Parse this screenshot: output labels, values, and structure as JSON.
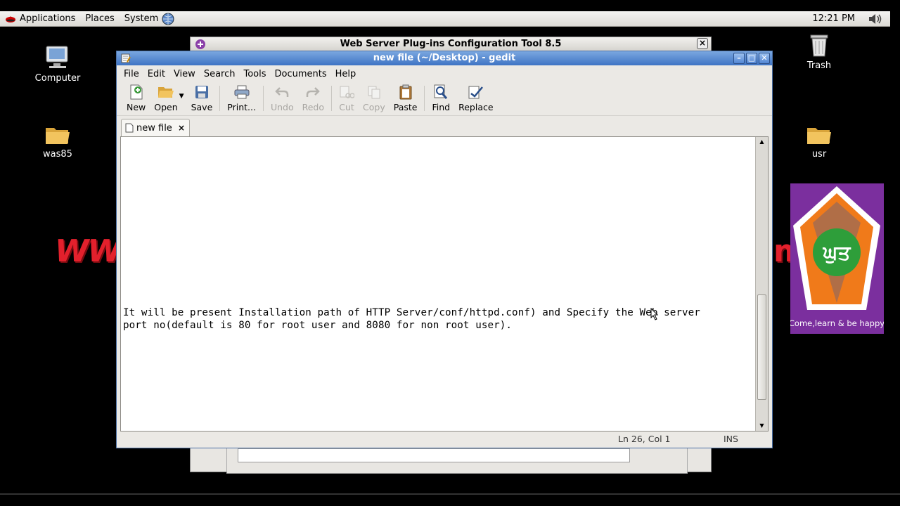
{
  "top_panel": {
    "applications": "Applications",
    "places": "Places",
    "system": "System",
    "clock": "12:21 PM"
  },
  "desktop": {
    "icons": [
      {
        "label": "Computer"
      },
      {
        "label": "was85"
      },
      {
        "label": "Trash"
      },
      {
        "label": "usr"
      }
    ],
    "watermark_left": "WW",
    "watermark_right": "m",
    "logo_text": "Come,learn & be happy",
    "logo_letters": "ਘੁਤ"
  },
  "background_window": {
    "title": "Web Server Plug-ins Configuration Tool 8.5",
    "close_label": "×"
  },
  "gedit": {
    "title": "new file (~/Desktop) - gedit",
    "menu": {
      "file": "File",
      "edit": "Edit",
      "view": "View",
      "search": "Search",
      "tools": "Tools",
      "documents": "Documents",
      "help": "Help"
    },
    "toolbar": {
      "new": "New",
      "open": "Open",
      "save": "Save",
      "print": "Print...",
      "undo": "Undo",
      "redo": "Redo",
      "cut": "Cut",
      "copy": "Copy",
      "paste": "Paste",
      "find": "Find",
      "replace": "Replace"
    },
    "tab": {
      "label": "new file",
      "close": "×"
    },
    "editor": {
      "line1": "It will be present Installation path of HTTP Server/conf/httpd.conf) and Specify the Web server",
      "line2": "port no(default is 80 for root user and 8080 for non root user)."
    },
    "status": {
      "position": "Ln 26, Col 1",
      "mode": "INS"
    }
  },
  "colors": {
    "title_blue": "#3e74c4",
    "panel_bg": "#dcdad5",
    "watermark_red": "#e3202c",
    "logo_purple": "#7b2f9e",
    "logo_orange": "#f07a1a",
    "logo_green": "#2e9e3a"
  }
}
